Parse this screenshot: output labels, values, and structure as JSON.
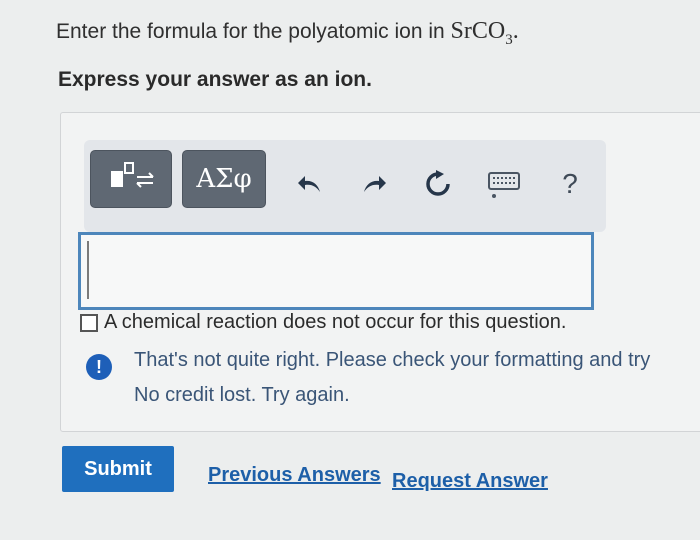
{
  "question": {
    "prompt_text": "Enter the formula for the polyatomic ion in ",
    "formula_base": "SrCO",
    "formula_sub": "3",
    "formula_end": ".",
    "instruction": "Express your answer as an ion."
  },
  "toolbar": {
    "template_icon": "template-symbol-icon",
    "greek_label": "ΑΣφ",
    "undo_icon": "undo-icon",
    "redo_icon": "redo-icon",
    "reset_icon": "reset-icon",
    "keyboard_icon": "keyboard-icon",
    "help_label": "?"
  },
  "answer": {
    "value": ""
  },
  "checkbox": {
    "label": "A chemical reaction does not occur for this question.",
    "checked": false
  },
  "feedback": {
    "icon": "!",
    "message": "That's not quite right. Please check your formatting and try",
    "sub_message": "No credit lost. Try again."
  },
  "actions": {
    "submit_label": "Submit",
    "previous_answers_label": "Previous Answers",
    "request_answer_label": "Request Answer"
  },
  "colors": {
    "accent": "#1f6fbe",
    "feedback_icon": "#1e5fb8",
    "input_border": "#4d86bb",
    "toolbar_button": "#5f6873"
  }
}
